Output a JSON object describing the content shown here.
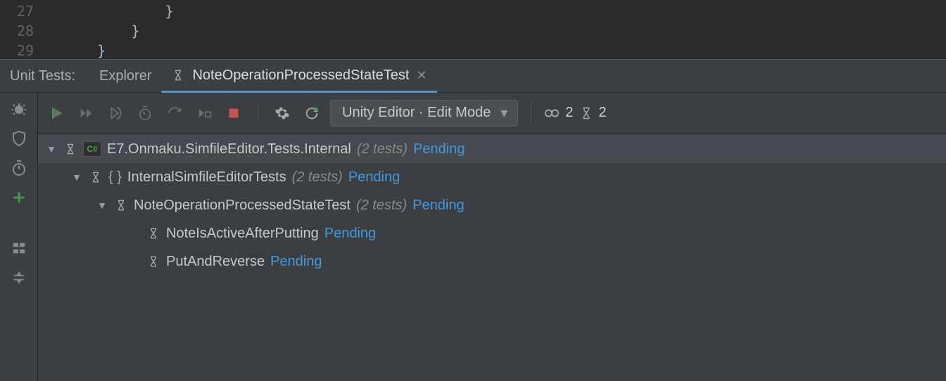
{
  "editor": {
    "lines": [
      {
        "num": "27",
        "text": "            }"
      },
      {
        "num": "28",
        "text": "        }"
      },
      {
        "num": "29",
        "text": "    }"
      }
    ]
  },
  "tabs": {
    "panel_label": "Unit Tests:",
    "explorer": "Explorer",
    "active": "NoteOperationProcessedStateTest"
  },
  "toolbar": {
    "dropdown": "Unity Editor · Edit Mode",
    "broken_count": "2",
    "pending_count": "2"
  },
  "tree": {
    "root": {
      "name": "E7.Onmaku.SimfileEditor.Tests.Internal",
      "count": "(2 tests)",
      "status": "Pending"
    },
    "ns1": {
      "name": "InternalSimfileEditorTests",
      "count": "(2 tests)",
      "status": "Pending"
    },
    "cls": {
      "name": "NoteOperationProcessedStateTest",
      "count": "(2 tests)",
      "status": "Pending"
    },
    "t1": {
      "name": "NoteIsActiveAfterPutting",
      "status": "Pending"
    },
    "t2": {
      "name": "PutAndReverse",
      "status": "Pending"
    }
  }
}
